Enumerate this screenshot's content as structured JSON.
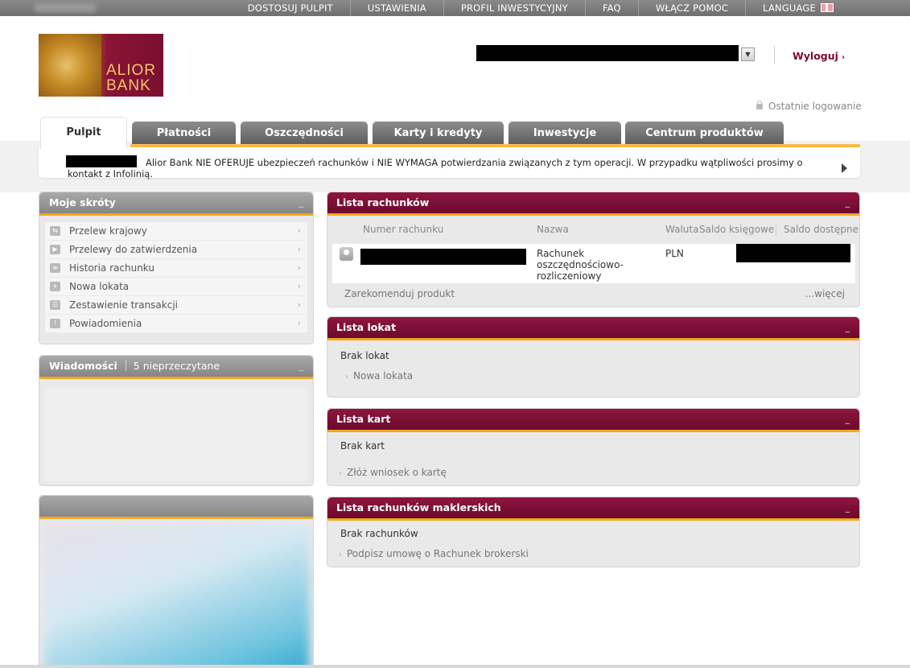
{
  "topnav": {
    "items": [
      "DOSTOSUJ PULPIT",
      "USTAWIENIA",
      "PROFIL INWESTYCYJNY",
      "FAQ",
      "WŁĄCZ POMOC"
    ],
    "language": "LANGUAGE"
  },
  "logo": {
    "line1": "ALIOR",
    "line2": "BANK"
  },
  "header": {
    "logout": "Wyloguj",
    "logout_arrow": "›",
    "last_login": "Ostatnie logowanie"
  },
  "tabs": [
    "Pulpit",
    "Płatności",
    "Oszczędności",
    "Karty i kredyty",
    "Inwestycje",
    "Centrum produktów"
  ],
  "notice": {
    "text": "Alior Bank NIE OFERUJE ubezpieczeń rachunków i NIE WYMAGA potwierdzania związanych z tym operacji. W przypadku wątpliwości prosimy o kontakt z Infolinią."
  },
  "shortcuts": {
    "title": "Moje skróty",
    "minimize": "_",
    "items": [
      {
        "label": "Przelew krajowy",
        "icon": "transfer-icon"
      },
      {
        "label": "Przelewy do zatwierdzenia",
        "icon": "play-icon"
      },
      {
        "label": "Historia rachunku",
        "icon": "history-icon"
      },
      {
        "label": "Nowa lokata",
        "icon": "deposit-icon"
      },
      {
        "label": "Zestawienie transakcji",
        "icon": "statement-icon"
      },
      {
        "label": "Powiadomienia",
        "icon": "notification-icon"
      }
    ],
    "chevron": "›"
  },
  "messages": {
    "title": "Wiadomości",
    "count": "5 nieprzeczytane",
    "minimize": "_"
  },
  "accounts": {
    "title": "Lista rachunków",
    "minimize": "_",
    "columns": [
      "Numer rachunku",
      "Nazwa",
      "Waluta",
      "Saldo księgowe",
      "Saldo dostępne"
    ],
    "rows": [
      {
        "name": "Rachunek oszczędnościowo-rozliczeniowy",
        "currency": "PLN"
      }
    ],
    "recommend": "Zarekomenduj produkt",
    "more": "...więcej"
  },
  "deposits": {
    "title": "Lista lokat",
    "minimize": "_",
    "empty": "Brak lokat",
    "link": "Nowa lokata"
  },
  "cards": {
    "title": "Lista kart",
    "minimize": "_",
    "empty": "Brak kart",
    "link": "Złóż wniosek o kartę"
  },
  "brokerage": {
    "title": "Lista rachunków maklerskich",
    "minimize": "_",
    "empty": "Brak rachunków",
    "link": "Podpisz umowę o Rachunek brokerski"
  },
  "colors": {
    "brand": "#7a0c2e",
    "accent": "#f1a81e",
    "tab_gray": "#6f6f6f"
  }
}
